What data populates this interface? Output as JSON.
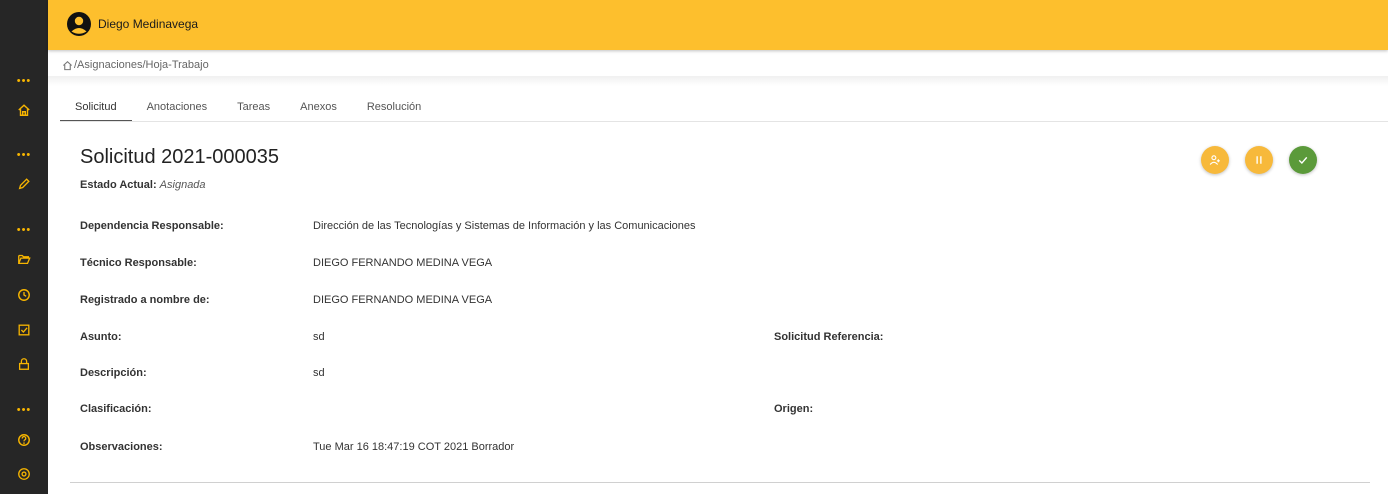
{
  "user": {
    "name": "Diego Medinavega"
  },
  "breadcrumb": {
    "path": "/Asignaciones/Hoja-Trabajo"
  },
  "sidebar": {
    "dots": "•••",
    "icons": [
      "home-icon",
      "pencil-icon",
      "folder-icon",
      "clock-icon",
      "checkbox-icon",
      "lock-icon",
      "help-icon",
      "eye-icon"
    ]
  },
  "tabs": [
    {
      "label": "Solicitud",
      "active": true
    },
    {
      "label": "Anotaciones",
      "active": false
    },
    {
      "label": "Tareas",
      "active": false
    },
    {
      "label": "Anexos",
      "active": false
    },
    {
      "label": "Resolución",
      "active": false
    }
  ],
  "header": {
    "title": "Solicitud 2021-000035",
    "estado_label": "Estado Actual:",
    "estado_value": "Asignada"
  },
  "actions": [
    {
      "name": "assign-user",
      "icon": "user-assign-icon"
    },
    {
      "name": "pause",
      "icon": "pause-icon"
    },
    {
      "name": "approve",
      "icon": "check-icon"
    }
  ],
  "fields": {
    "dependencia": {
      "label": "Dependencia Responsable:",
      "value": "Dirección de las Tecnologías y Sistemas de Información y las Comunicaciones"
    },
    "tecnico": {
      "label": "Técnico Responsable:",
      "value": "DIEGO FERNANDO MEDINA VEGA"
    },
    "registrado": {
      "label": "Registrado a nombre de:",
      "value": "DIEGO FERNANDO MEDINA VEGA"
    },
    "asunto": {
      "label": "Asunto:",
      "value": "sd"
    },
    "referencia": {
      "label": "Solicitud Referencia:",
      "value": ""
    },
    "descripcion": {
      "label": "Descripción:",
      "value": "sd"
    },
    "clasificacion": {
      "label": "Clasificación:",
      "value": ""
    },
    "origen": {
      "label": "Origen:",
      "value": ""
    },
    "observaciones": {
      "label": "Observaciones:",
      "value": "Tue Mar 16 18:47:19 COT 2021 Borrador"
    }
  },
  "colors": {
    "topbar": "#fdbf2d",
    "sidebar": "#262626",
    "accent": "#f7b500",
    "action_yellow": "#f7b93b",
    "action_green": "#5b9a3a"
  }
}
